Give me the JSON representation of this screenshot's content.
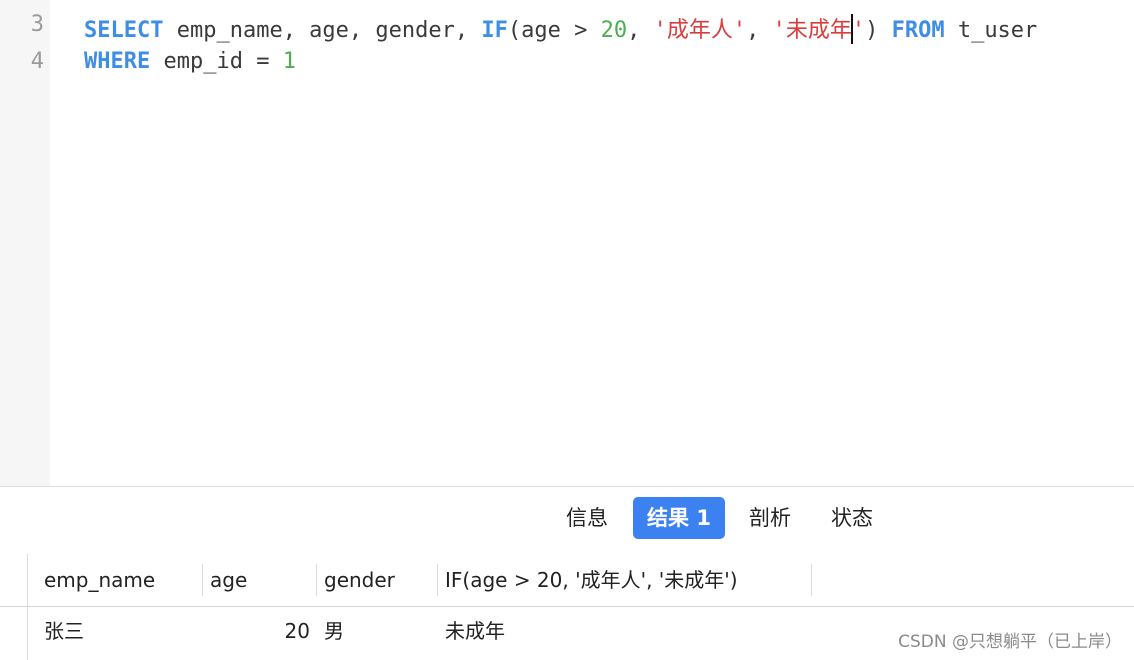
{
  "editor": {
    "lines": [
      {
        "number": "3",
        "tokens": {
          "t0": "SELECT",
          "t1": " emp_name, age, gender, ",
          "t2": "IF",
          "t3": "(age > ",
          "t4": "20",
          "t5": ", ",
          "t6": "'成年人'",
          "t7": ", ",
          "t8a": "'未成年",
          "t8b": "'",
          "t9": ") ",
          "t10": "FROM",
          "t11": " t_user"
        }
      },
      {
        "number": "4",
        "tokens": {
          "t0": "WHERE",
          "t1": " emp_id = ",
          "t2": "1"
        }
      }
    ]
  },
  "tabs": [
    {
      "label": "信息",
      "active": false
    },
    {
      "label": "结果 1",
      "active": true
    },
    {
      "label": "剖析",
      "active": false
    },
    {
      "label": "状态",
      "active": false
    }
  ],
  "result": {
    "columns": [
      "emp_name",
      "age",
      "gender",
      "IF(age > 20, '成年人', '未成年')"
    ],
    "rows": [
      [
        "张三",
        "20",
        "男",
        "未成年"
      ]
    ]
  },
  "watermark": "CSDN @只想躺平（已上岸）",
  "colors": {
    "keyword": "#3f8ee6",
    "number": "#4cae4f",
    "string": "#dc3c3c",
    "active_tab": "#3b82f0"
  }
}
